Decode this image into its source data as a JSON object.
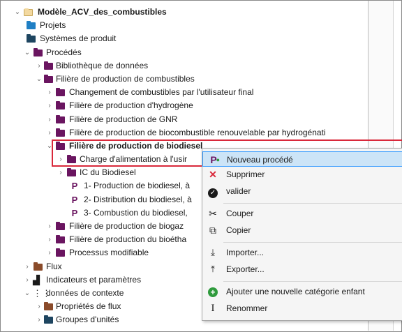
{
  "tree": {
    "root": "Modèle_ACV_des_combustibles",
    "projets": "Projets",
    "systemes": "Systèmes de produit",
    "procedes": "Procédés",
    "bibliotheque": "Bibliothèque de données",
    "filiere_combustibles": "Filière de production de combustibles",
    "changement": "Changement de combustibles par l'utilisateur final",
    "hydrogene": "Filière de production d'hydrogène",
    "gnr": "Filière de production de GNR",
    "biocombustible": "Filière de production de biocombustible renouvelable par hydrogénati",
    "biodiesel": "Filière de production de biodiesel",
    "charge": "Charge d'alimentation à l'usir",
    "ic": "IC du Biodiesel",
    "p1": "1- Production de biodiesel, à",
    "p2": "2- Distribution du biodiesel, à",
    "p3": "3- Combustion du biodiesel,",
    "biogaz": "Filière de production de biogaz",
    "bioetha": "Filière de production du bioétha",
    "processus": "Processus modifiable",
    "flux": "Flux",
    "indicateurs": "Indicateurs et paramètres",
    "donnees": "données de contexte",
    "proprietes": "Propriétés de flux",
    "groupes": "Groupes d'unités",
    "process_marker": "P"
  },
  "context_menu": {
    "items": [
      {
        "label": "Nouveau procédé",
        "icon": "new-process-icon"
      },
      {
        "label": "Supprimer",
        "icon": "delete-x-icon"
      },
      {
        "label": "valider",
        "icon": "validate-check-icon"
      },
      {
        "label": "Couper",
        "icon": "scissors-icon"
      },
      {
        "label": "Copier",
        "icon": "copy-icon"
      },
      {
        "label": "Importer...",
        "icon": "import-icon"
      },
      {
        "label": "Exporter...",
        "icon": "export-icon"
      },
      {
        "label": "Ajouter une nouvelle catégorie enfant",
        "icon": "add-child-icon"
      },
      {
        "label": "Renommer",
        "icon": "rename-icon"
      }
    ],
    "highlighted_index": 0
  },
  "colors": {
    "highlight_border": "#d9283a",
    "menu_highlight": "#cce4f7",
    "process_folder": "#6a1560",
    "blue_folder": "#1f7fc4"
  }
}
